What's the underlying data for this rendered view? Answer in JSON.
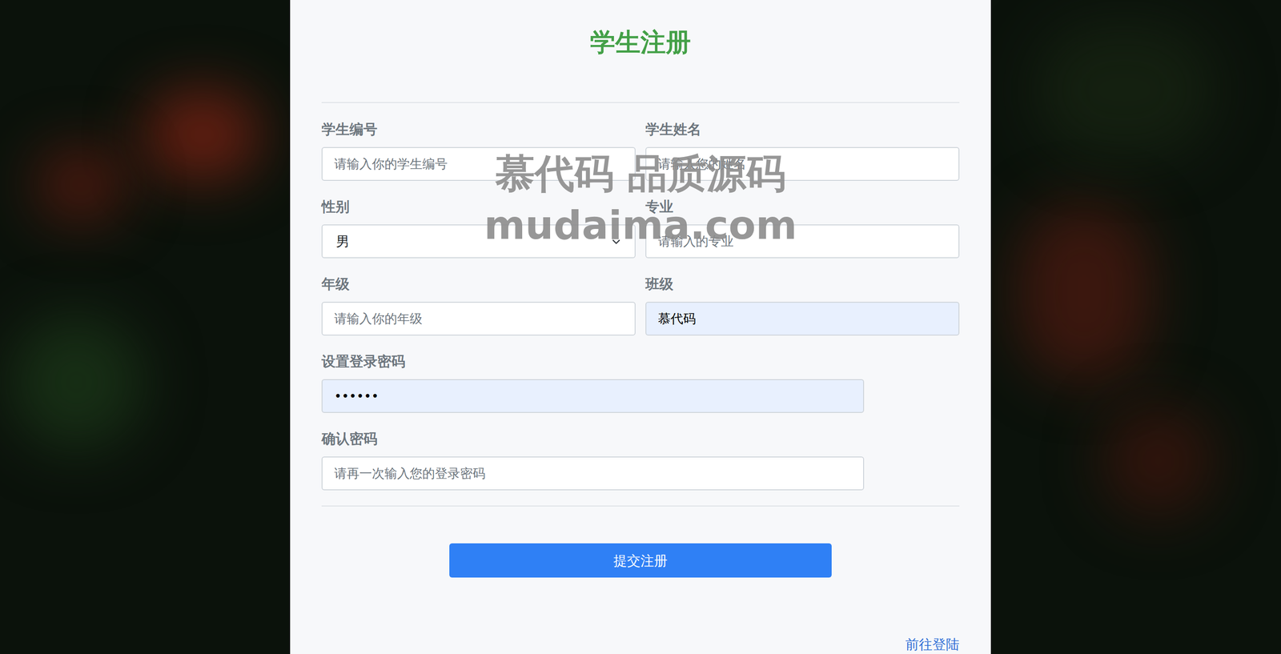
{
  "title": "学生注册",
  "fields": [
    {
      "label": "学生编号",
      "kind": "input",
      "placeholder": "请输入你的学生编号",
      "autofilled": false
    },
    {
      "label": "学生姓名",
      "kind": "input",
      "placeholder": "请输入您的姓名",
      "autofilled": false
    },
    {
      "label": "性别",
      "kind": "select",
      "value": "男",
      "autofilled": false
    },
    {
      "label": "专业",
      "kind": "input",
      "placeholder": "请输入的专业",
      "autofilled": false
    },
    {
      "label": "年级",
      "kind": "input",
      "placeholder": "请输入你的年级",
      "autofilled": false
    },
    {
      "label": "班级",
      "kind": "input",
      "value": "慕代码",
      "autofilled": true
    }
  ],
  "password_fields": [
    {
      "label": "设置登录密码",
      "kind": "input",
      "value": "••••••",
      "autofilled": true
    },
    {
      "label": "确认密码",
      "kind": "input",
      "placeholder": "请再一次输入您的登录密码",
      "autofilled": false
    }
  ],
  "submit": "提交注册",
  "login_link": "前往登陆",
  "watermark": [
    "慕代码 品质源码",
    "mudaima.com"
  ]
}
